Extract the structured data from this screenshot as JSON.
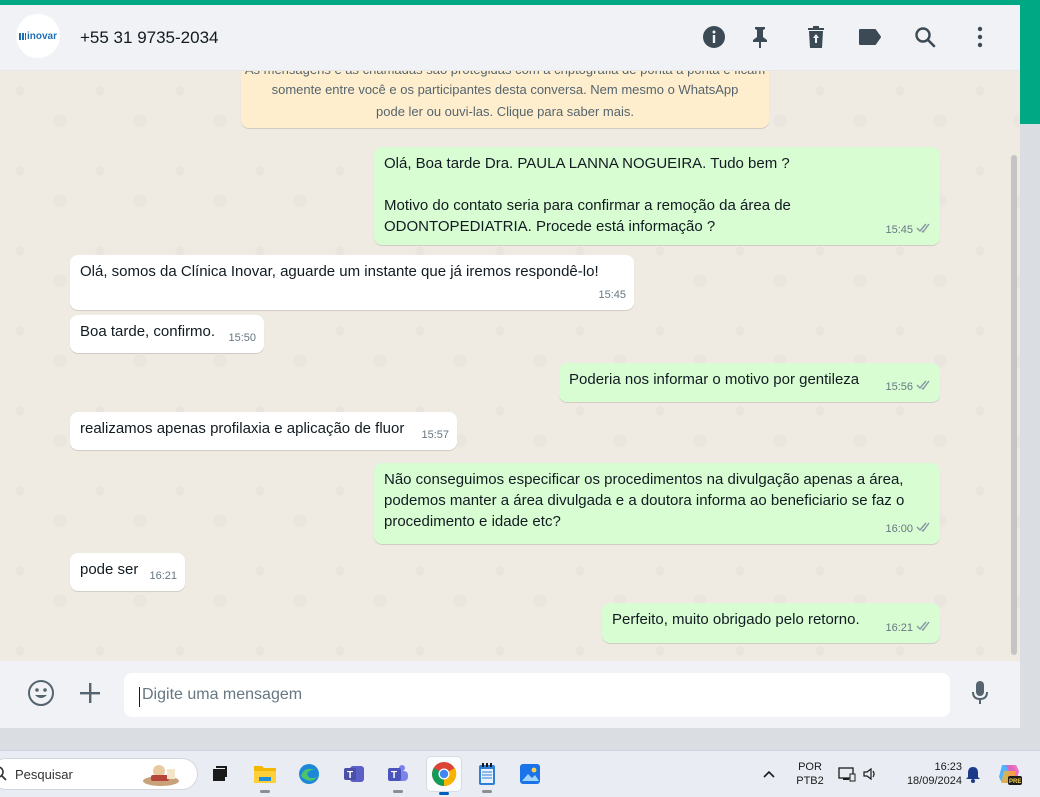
{
  "header": {
    "logo_text": "inovar",
    "contact_name": "+55 31 9735-2034"
  },
  "encryption_notice": {
    "line0": "As mensagens e as chamadas são protegidas com a criptografia de ponta a ponta e ficam",
    "line1": "somente entre você e os participantes desta conversa. Nem mesmo o WhatsApp",
    "line2": "pode ler ou ouvi-las. Clique para saber mais."
  },
  "messages": [
    {
      "dir": "out",
      "text": "Olá, Boa tarde Dra. PAULA LANNA NOGUEIRA. Tudo bem ?\n\nMotivo do contato seria para confirmar a remoção da área de\nODONTOPEDIATRIA. Procede está informação ?",
      "time": "15:45"
    },
    {
      "dir": "in",
      "text": "Olá, somos da Clínica Inovar, aguarde um instante que já iremos respondê-lo!",
      "time": "15:45"
    },
    {
      "dir": "in",
      "text": "Boa tarde, confirmo.",
      "time": "15:50"
    },
    {
      "dir": "out",
      "text": "Poderia nos informar o motivo por gentileza",
      "time": "15:56"
    },
    {
      "dir": "in",
      "text": "realizamos apenas profilaxia e aplicação de fluor",
      "time": "15:57"
    },
    {
      "dir": "out",
      "text": "Não conseguimos especificar os procedimentos na divulgação apenas a área,\npodemos manter a área divulgada e a doutora informa ao beneficiario se faz o\nprocedimento e idade etc?",
      "time": "16:00"
    },
    {
      "dir": "in",
      "text": "pode ser",
      "time": "16:21"
    },
    {
      "dir": "out",
      "text": "Perfeito, muito obrigado pelo retorno.",
      "time": "16:21"
    }
  ],
  "composer": {
    "placeholder": "Digite uma mensagem"
  },
  "taskbar": {
    "search_placeholder": "Pesquisar",
    "lang_line1": "POR",
    "lang_line2": "PTB2",
    "time": "16:23",
    "date": "18/09/2024"
  },
  "colors": {
    "accent": "#00a884",
    "outgoing_bubble": "#d9fdd3",
    "incoming_bubble": "#ffffff",
    "tick_color": "#8696a0"
  }
}
